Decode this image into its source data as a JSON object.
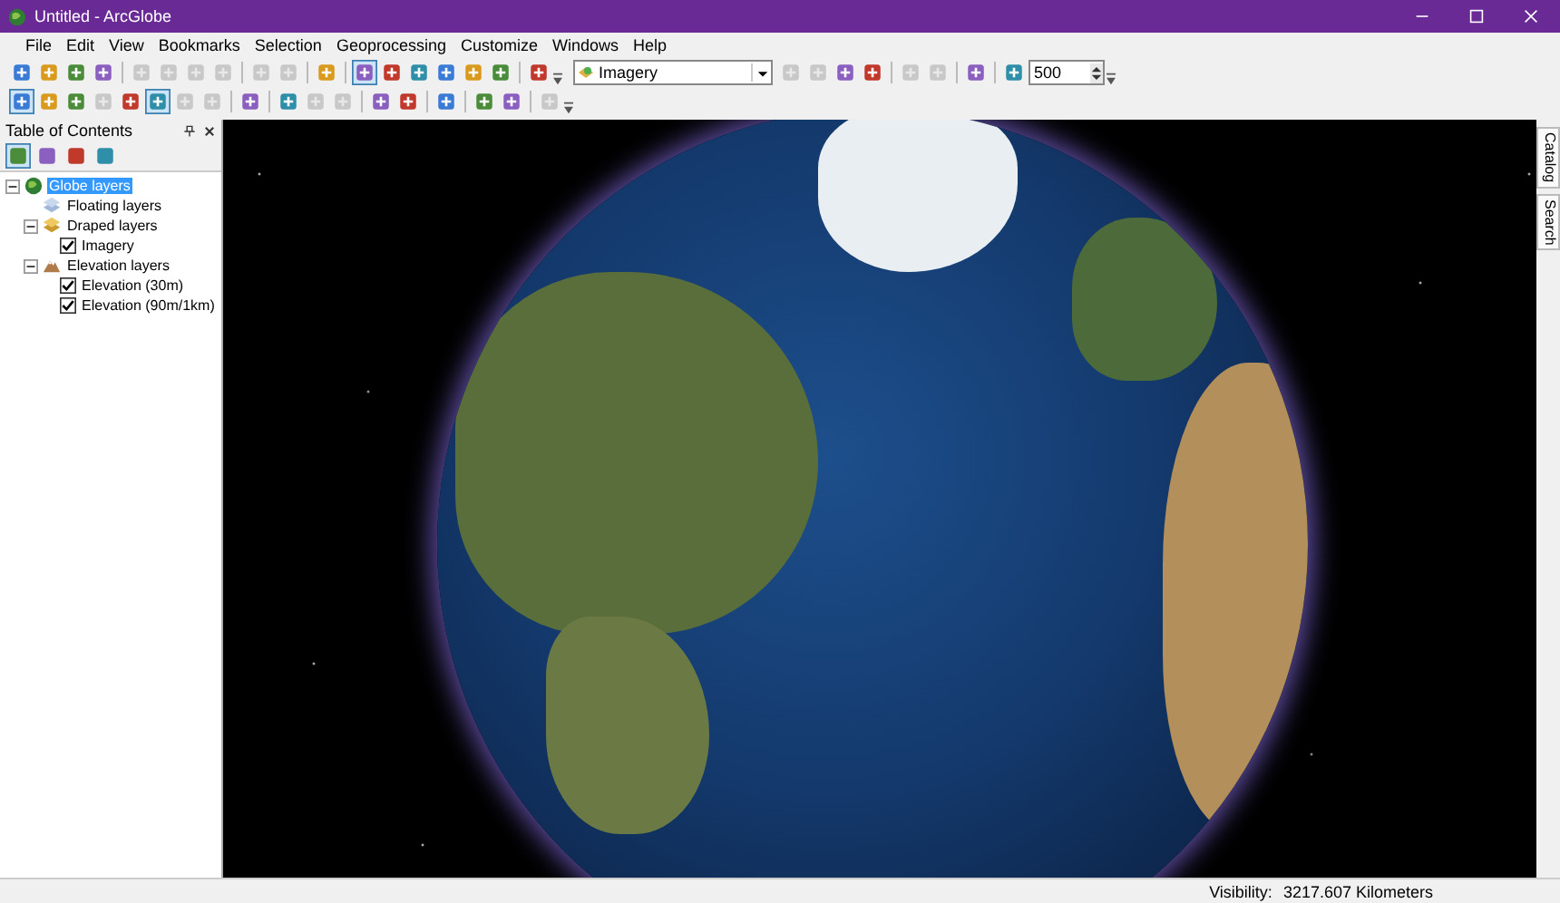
{
  "window": {
    "title": "Untitled - ArcGlobe"
  },
  "menu": [
    "File",
    "Edit",
    "View",
    "Bookmarks",
    "Selection",
    "Geoprocessing",
    "Customize",
    "Windows",
    "Help"
  ],
  "toolbar_1": [
    {
      "kind": "tool",
      "disabled": false,
      "selected": false
    },
    {
      "kind": "tool",
      "disabled": false,
      "selected": false
    },
    {
      "kind": "tool",
      "disabled": false,
      "selected": false
    },
    {
      "kind": "tool",
      "disabled": false,
      "selected": false
    },
    {
      "kind": "sep"
    },
    {
      "kind": "tool",
      "disabled": true,
      "selected": false
    },
    {
      "kind": "tool",
      "disabled": true,
      "selected": false
    },
    {
      "kind": "tool",
      "disabled": true,
      "selected": false
    },
    {
      "kind": "tool",
      "disabled": true,
      "selected": false
    },
    {
      "kind": "sep"
    },
    {
      "kind": "tool",
      "disabled": true,
      "selected": false
    },
    {
      "kind": "tool",
      "disabled": true,
      "selected": false
    },
    {
      "kind": "sep"
    },
    {
      "kind": "tool",
      "disabled": false,
      "selected": false
    },
    {
      "kind": "sep"
    },
    {
      "kind": "tool",
      "disabled": false,
      "selected": true
    },
    {
      "kind": "tool",
      "disabled": false,
      "selected": false
    },
    {
      "kind": "tool",
      "disabled": false,
      "selected": false
    },
    {
      "kind": "tool",
      "disabled": false,
      "selected": false
    },
    {
      "kind": "tool",
      "disabled": false,
      "selected": false
    },
    {
      "kind": "tool",
      "disabled": false,
      "selected": false
    },
    {
      "kind": "sep"
    },
    {
      "kind": "tool",
      "disabled": false,
      "selected": false
    },
    {
      "kind": "grip"
    },
    {
      "kind": "combo",
      "value": "Imagery"
    },
    {
      "kind": "tool",
      "disabled": true,
      "selected": false
    },
    {
      "kind": "tool",
      "disabled": true,
      "selected": false
    },
    {
      "kind": "tool",
      "disabled": false,
      "selected": false
    },
    {
      "kind": "tool",
      "disabled": false,
      "selected": false
    },
    {
      "kind": "sep"
    },
    {
      "kind": "tool",
      "disabled": true,
      "selected": false
    },
    {
      "kind": "tool",
      "disabled": true,
      "selected": false
    },
    {
      "kind": "sep"
    },
    {
      "kind": "tool",
      "disabled": false,
      "selected": false
    },
    {
      "kind": "sep"
    },
    {
      "kind": "tool",
      "disabled": false,
      "selected": false
    },
    {
      "kind": "spin",
      "value": "500"
    },
    {
      "kind": "grip"
    }
  ],
  "toolbar_2": [
    {
      "kind": "tool",
      "disabled": false,
      "selected": true
    },
    {
      "kind": "tool",
      "disabled": false,
      "selected": false
    },
    {
      "kind": "tool",
      "disabled": false,
      "selected": false
    },
    {
      "kind": "tool",
      "disabled": true,
      "selected": false
    },
    {
      "kind": "tool",
      "disabled": false,
      "selected": false
    },
    {
      "kind": "tool",
      "disabled": false,
      "selected": true
    },
    {
      "kind": "tool",
      "disabled": true,
      "selected": false
    },
    {
      "kind": "tool",
      "disabled": true,
      "selected": false
    },
    {
      "kind": "sep"
    },
    {
      "kind": "tool",
      "disabled": false,
      "selected": false
    },
    {
      "kind": "sep"
    },
    {
      "kind": "tool",
      "disabled": false,
      "selected": false
    },
    {
      "kind": "tool",
      "disabled": true,
      "selected": false
    },
    {
      "kind": "tool",
      "disabled": true,
      "selected": false
    },
    {
      "kind": "sep"
    },
    {
      "kind": "tool",
      "disabled": false,
      "selected": false
    },
    {
      "kind": "tool",
      "disabled": false,
      "selected": false
    },
    {
      "kind": "sep"
    },
    {
      "kind": "tool",
      "disabled": false,
      "selected": false
    },
    {
      "kind": "sep"
    },
    {
      "kind": "tool",
      "disabled": false,
      "selected": false
    },
    {
      "kind": "tool",
      "disabled": false,
      "selected": false
    },
    {
      "kind": "sep"
    },
    {
      "kind": "tool",
      "disabled": true,
      "selected": false
    },
    {
      "kind": "grip"
    }
  ],
  "toc": {
    "title": "Table of Contents",
    "tree": [
      {
        "label": "Globe layers",
        "kind": "globe",
        "selected": true,
        "expanded": true,
        "children": [
          {
            "label": "Floating layers",
            "kind": "floating",
            "selected": false
          },
          {
            "label": "Draped layers",
            "kind": "draped",
            "selected": false,
            "expanded": true,
            "children": [
              {
                "label": "Imagery",
                "kind": "layer",
                "selected": false,
                "checked": true
              }
            ]
          },
          {
            "label": "Elevation layers",
            "kind": "elevation",
            "selected": false,
            "expanded": true,
            "children": [
              {
                "label": "Elevation (30m)",
                "kind": "layer",
                "selected": false,
                "checked": true
              },
              {
                "label": "Elevation (90m/1km)",
                "kind": "layer",
                "selected": false,
                "checked": true
              }
            ]
          }
        ]
      }
    ]
  },
  "side_tabs": [
    "Catalog",
    "Search"
  ],
  "status_bar": {
    "visibility_label": "Visibility:",
    "visibility_value": "3217.607 Kilometers"
  }
}
